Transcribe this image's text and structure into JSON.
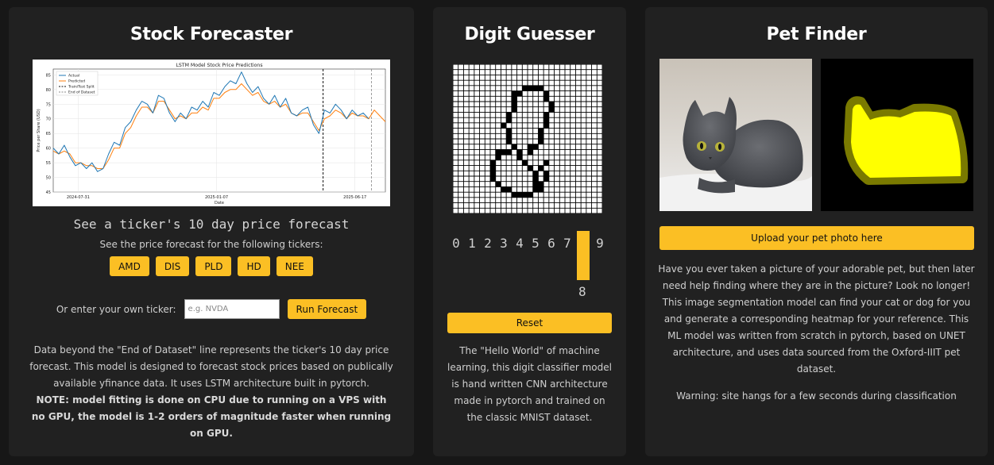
{
  "stock": {
    "title": "Stock Forecaster",
    "chart_title": "LSTM Model Stock Price Predictions",
    "subtitle": "See a ticker's 10 day price forecast",
    "tickers_caption": "See the price forecast for the following tickers:",
    "tickers": [
      "AMD",
      "DIS",
      "PLD",
      "HD",
      "NEE"
    ],
    "own_label": "Or enter your own ticker:",
    "input_placeholder": "e.g. NVDA",
    "run_label": "Run Forecast",
    "desc_1": "Data beyond the \"End of Dataset\" line represents the ticker's 10 day price forecast. This model is designed to forecast stock prices based on publically available yfinance data. It uses LSTM architecture built in pytorch.",
    "desc_note": "NOTE: model fitting is done on CPU due to running on a VPS with no GPU, the model is 1-2 orders of magnitude faster when running on GPU."
  },
  "chart_data": {
    "type": "line",
    "title": "LSTM Model Stock Price Predictions",
    "xlabel": "Date",
    "ylabel": "Price per Share (USD)",
    "ylim": [
      45,
      87
    ],
    "yticks": [
      45,
      50,
      55,
      60,
      65,
      70,
      75,
      80,
      85
    ],
    "xticks": [
      "2024-07-31",
      "2025-01-07",
      "2025-06-17"
    ],
    "x_range": [
      0,
      240
    ],
    "xtick_positions": [
      18,
      118,
      218
    ],
    "split_x": 195,
    "end_x": 230,
    "grid": true,
    "legend": "top-left",
    "legend_entries": [
      "Actual",
      "Predicted",
      "Train/Test Split",
      "End of Dataset"
    ],
    "colors": {
      "actual": "#1f77b4",
      "predicted": "#ff7f0e"
    },
    "series": [
      {
        "name": "Actual",
        "x": [
          0,
          4,
          8,
          12,
          16,
          20,
          24,
          28,
          32,
          36,
          40,
          44,
          48,
          52,
          56,
          60,
          64,
          68,
          72,
          76,
          80,
          84,
          88,
          92,
          96,
          100,
          104,
          108,
          112,
          116,
          120,
          124,
          128,
          132,
          136,
          140,
          144,
          148,
          152,
          156,
          160,
          164,
          168,
          172,
          176,
          180,
          184,
          188,
          192,
          196,
          200,
          204,
          208,
          212,
          216,
          220,
          224,
          228
        ],
        "values": [
          60,
          58,
          61,
          57,
          54,
          55,
          53,
          55,
          52,
          53,
          58,
          62,
          61,
          67,
          69,
          73,
          76,
          75,
          72,
          78,
          77,
          72,
          69,
          72,
          70,
          74,
          73,
          76,
          74,
          79,
          78,
          81,
          83,
          82,
          86,
          82,
          79,
          81,
          77,
          75,
          78,
          74,
          77,
          72,
          71,
          73,
          74,
          68,
          65,
          73,
          72,
          75,
          73,
          70,
          73,
          71,
          72,
          70
        ]
      },
      {
        "name": "Predicted",
        "x": [
          0,
          4,
          8,
          12,
          16,
          20,
          24,
          28,
          32,
          36,
          40,
          44,
          48,
          52,
          56,
          60,
          64,
          68,
          72,
          76,
          80,
          84,
          88,
          92,
          96,
          100,
          104,
          108,
          112,
          116,
          120,
          124,
          128,
          132,
          136,
          140,
          144,
          148,
          152,
          156,
          160,
          164,
          168,
          172,
          176,
          180,
          184,
          188,
          192,
          196,
          200,
          204,
          208,
          212,
          216,
          220,
          224,
          228,
          232,
          236,
          240
        ],
        "values": [
          59,
          58,
          59,
          58,
          55,
          55,
          54,
          54,
          53,
          53,
          56,
          60,
          60,
          65,
          67,
          71,
          74,
          74,
          72,
          76,
          76,
          73,
          70,
          71,
          70,
          72,
          72,
          74,
          73,
          77,
          77,
          79,
          80,
          80,
          82,
          80,
          78,
          79,
          76,
          75,
          76,
          74,
          75,
          72,
          71,
          72,
          72,
          69,
          66,
          70,
          71,
          73,
          72,
          70,
          72,
          71,
          71,
          70,
          73,
          71,
          69
        ]
      }
    ]
  },
  "digit": {
    "title": "Digit Guesser",
    "digits": [
      "0",
      "1",
      "2",
      "3",
      "4",
      "5",
      "6",
      "7",
      "8",
      "9"
    ],
    "highlight": "8",
    "confidence": 1.0,
    "predicted": "8",
    "reset_label": "Reset",
    "desc": "The \"Hello World\" of machine learning, this digit classifier model is hand written CNN architecture made in pytorch and trained on the classic MNIST dataset.",
    "drawing": [
      [
        11,
        5
      ],
      [
        11,
        6
      ],
      [
        11,
        7
      ],
      [
        11,
        8
      ],
      [
        10,
        9
      ],
      [
        10,
        10
      ],
      [
        9,
        11
      ],
      [
        10,
        12
      ],
      [
        10,
        13
      ],
      [
        10,
        14
      ],
      [
        11,
        15
      ],
      [
        12,
        16
      ],
      [
        12,
        17
      ],
      [
        13,
        18
      ],
      [
        14,
        19
      ],
      [
        15,
        20
      ],
      [
        15,
        21
      ],
      [
        15,
        22
      ],
      [
        12,
        5
      ],
      [
        13,
        4
      ],
      [
        14,
        4
      ],
      [
        15,
        4
      ],
      [
        16,
        4
      ],
      [
        17,
        5
      ],
      [
        17,
        6
      ],
      [
        18,
        7
      ],
      [
        18,
        8
      ],
      [
        17,
        9
      ],
      [
        17,
        10
      ],
      [
        17,
        11
      ],
      [
        16,
        12
      ],
      [
        16,
        13
      ],
      [
        16,
        14
      ],
      [
        15,
        15
      ],
      [
        14,
        15
      ],
      [
        14,
        16
      ],
      [
        10,
        16
      ],
      [
        9,
        16
      ],
      [
        8,
        16
      ],
      [
        8,
        17
      ],
      [
        7,
        18
      ],
      [
        7,
        19
      ],
      [
        7,
        20
      ],
      [
        7,
        21
      ],
      [
        8,
        22
      ],
      [
        9,
        23
      ],
      [
        10,
        23
      ],
      [
        11,
        24
      ],
      [
        12,
        24
      ],
      [
        13,
        24
      ],
      [
        14,
        24
      ],
      [
        15,
        23
      ],
      [
        16,
        23
      ],
      [
        16,
        22
      ],
      [
        17,
        21
      ],
      [
        17,
        20
      ],
      [
        16,
        19
      ],
      [
        17,
        18
      ]
    ]
  },
  "pet": {
    "title": "Pet Finder",
    "upload_label": "Upload your pet photo here",
    "desc": "Have you ever taken a picture of your adorable pet, but then later need help finding where they are in the picture? Look no longer! This image segmentation model can find your cat or dog for you and generate a corresponding heatmap for your reference. This ML model was written from scratch in pytorch, based on UNET architecture, and uses data sourced from the Oxford-IIIT pet dataset.",
    "warning": "Warning: site hangs for a few seconds during classification",
    "mask_color": "#ffff00"
  }
}
